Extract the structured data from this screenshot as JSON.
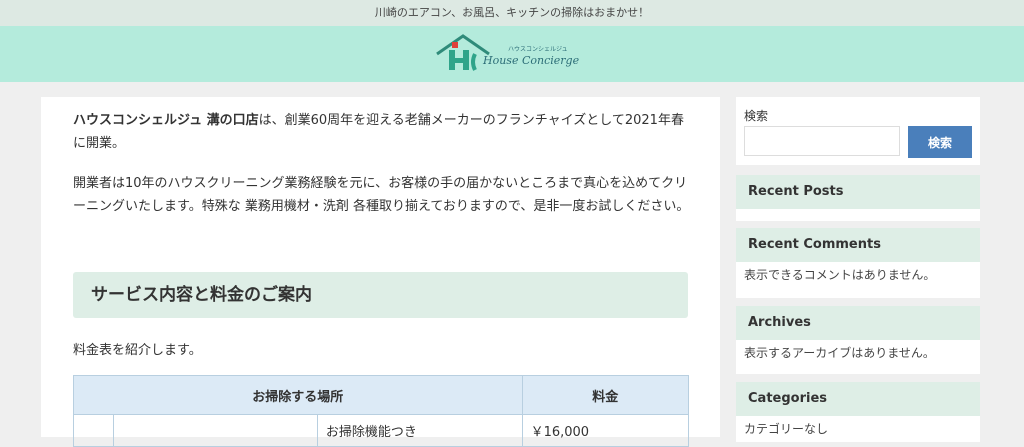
{
  "topbar": {
    "tagline": "川崎のエアコン、お風呂、キッチンの掃除はおまかせ！"
  },
  "logo": {
    "text": "House Concierge",
    "kana": "ハウスコンシェルジュ"
  },
  "main": {
    "p1_bold": "ハウスコンシェルジュ 溝の口店",
    "p1_rest": "は、創業60周年を迎える老舗メーカーのフランチャイズとして2021年春に開業。",
    "p2": "開業者は10年のハウスクリーニング業務経験を元に、お客様の手の届かないところまで真心を込めてクリーニングいたします。特殊な 業務用機材・洗剤 各種取り揃えておりますので、是非一度お試しください。",
    "section_heading": "サービス内容と料金のご案内",
    "p3": "料金表を紹介します。",
    "table": {
      "col_location": "お掃除する場所",
      "col_price": "料金",
      "row1_desc": "お掃除機能つき",
      "row1_price": "￥16,000"
    }
  },
  "sidebar": {
    "search": {
      "label": "検索",
      "button": "検索",
      "placeholder": ""
    },
    "recent_posts": {
      "title": "Recent Posts"
    },
    "recent_comments": {
      "title": "Recent Comments",
      "empty": "表示できるコメントはありません。"
    },
    "archives": {
      "title": "Archives",
      "empty": "表示するアーカイブはありません。"
    },
    "categories": {
      "title": "Categories",
      "empty": "カテゴリーなし"
    }
  }
}
